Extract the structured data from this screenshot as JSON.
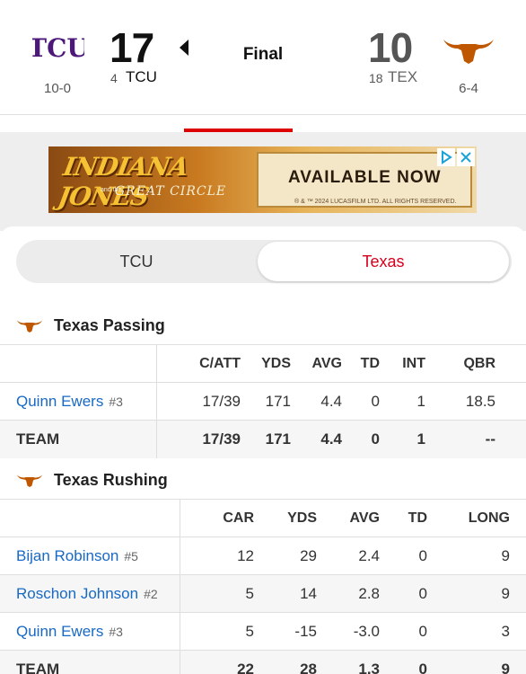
{
  "header": {
    "away": {
      "abbr": "TCU",
      "logo_text": "TCU",
      "score": "17",
      "rank": "4",
      "record": "10-0",
      "color": "#4d1979"
    },
    "home": {
      "abbr": "TEX",
      "score": "10",
      "rank": "18",
      "record": "6-4",
      "logo_icon": "longhorn-icon",
      "color": "#bf5700"
    },
    "status": "Final",
    "possession_icon": "left-arrow-icon"
  },
  "ad": {
    "title": "INDIANA JONES",
    "subtitle": "GREAT CIRCLE",
    "small_text": "and the",
    "cta": "AVAILABLE NOW",
    "legal": "® & ™ 2024 LUCASFILM LTD. ALL RIGHTS RESERVED.",
    "choice_icon": "adchoices-icon",
    "close_icon": "close-icon"
  },
  "team_toggle": {
    "options": [
      "TCU",
      "Texas"
    ],
    "selected": "Texas",
    "accent": "#d6001c"
  },
  "passing": {
    "title": "Texas Passing",
    "columns": [
      "C/ATT",
      "YDS",
      "AVG",
      "TD",
      "INT",
      "QBR"
    ],
    "rows": [
      {
        "name": "Quinn Ewers",
        "jersey": "#3",
        "values": [
          "17/39",
          "171",
          "4.4",
          "0",
          "1",
          "18.5"
        ]
      }
    ],
    "team": {
      "label": "TEAM",
      "values": [
        "17/39",
        "171",
        "4.4",
        "0",
        "1",
        "--"
      ]
    }
  },
  "rushing": {
    "title": "Texas Rushing",
    "columns": [
      "CAR",
      "YDS",
      "AVG",
      "TD",
      "LONG"
    ],
    "rows": [
      {
        "name": "Bijan Robinson",
        "jersey": "#5",
        "values": [
          "12",
          "29",
          "2.4",
          "0",
          "9"
        ]
      },
      {
        "name": "Roschon Johnson",
        "jersey": "#2",
        "values": [
          "5",
          "14",
          "2.8",
          "0",
          "9"
        ]
      },
      {
        "name": "Quinn Ewers",
        "jersey": "#3",
        "values": [
          "5",
          "-15",
          "-3.0",
          "0",
          "3"
        ]
      }
    ],
    "team": {
      "label": "TEAM",
      "values": [
        "22",
        "28",
        "1.3",
        "0",
        "9"
      ]
    }
  }
}
